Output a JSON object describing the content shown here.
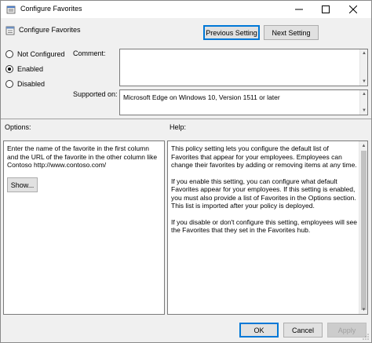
{
  "window": {
    "title": "Configure Favorites"
  },
  "header": {
    "policy_title": "Configure Favorites",
    "prev_label": "Previous Setting",
    "next_label": "Next Setting"
  },
  "state": {
    "options": [
      {
        "label": "Not Configured",
        "selected": false
      },
      {
        "label": "Enabled",
        "selected": true
      },
      {
        "label": "Disabled",
        "selected": false
      }
    ]
  },
  "comment": {
    "label": "Comment:",
    "value": ""
  },
  "supported": {
    "label": "Supported on:",
    "value": "Microsoft Edge on Windows 10, Version 1511 or later"
  },
  "options_panel": {
    "label": "Options:",
    "description": "Enter the name of the favorite in the first column and the URL of the favorite in the other column like Contoso http://www.contoso.com/",
    "show_label": "Show..."
  },
  "help_panel": {
    "label": "Help:",
    "paragraphs": [
      "This policy setting lets you configure the default list of Favorites that appear for your employees. Employees can change their favorites by adding or removing items at any time.",
      "If you enable this setting, you can configure what default Favorites appear for your employees. If this setting is enabled, you must also provide a list of Favorites in the Options section. This list is imported after your policy is deployed.",
      "If you disable or don't configure this setting, employees will see the Favorites that they set in the Favorites hub."
    ]
  },
  "footer": {
    "ok_label": "OK",
    "cancel_label": "Cancel",
    "apply_label": "Apply"
  },
  "colors": {
    "accent": "#0078d7",
    "window_bg": "#f0f0f0"
  }
}
